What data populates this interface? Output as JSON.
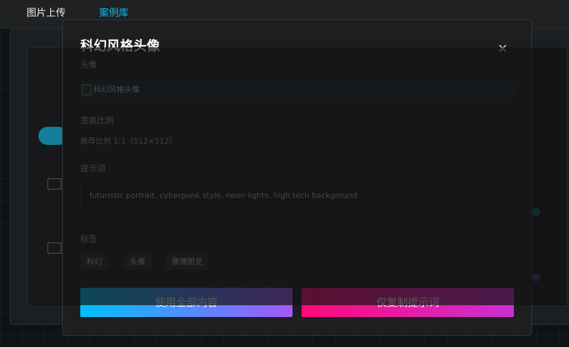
{
  "tabs": [
    {
      "label": "图片上传",
      "active": false
    },
    {
      "label": "案例库",
      "active": true
    }
  ],
  "modal": {
    "title": "科幻风格头像",
    "close_symbol": "×",
    "cover_label": "头像",
    "image_alt": "科幻风格头像",
    "ratio_label": "宽高比例",
    "ratio_value": "推荐比例 1:1（512×512）",
    "prompt_label": "提示词",
    "prompt_text": "futuristic portrait, cyberpunk style, neon lights, high tech background",
    "tags_label": "标签",
    "tags": [
      "科幻",
      "头像",
      "赛博朋克"
    ],
    "apply_button": "使用全部内容",
    "copy_button": "仅复制提示词"
  },
  "colors": {
    "accent": "#19b9e6",
    "apply_gradient": [
      "#00c2ff",
      "#a259f7"
    ],
    "copy_gradient": [
      "#ff0a78",
      "#cc2fd4"
    ]
  }
}
